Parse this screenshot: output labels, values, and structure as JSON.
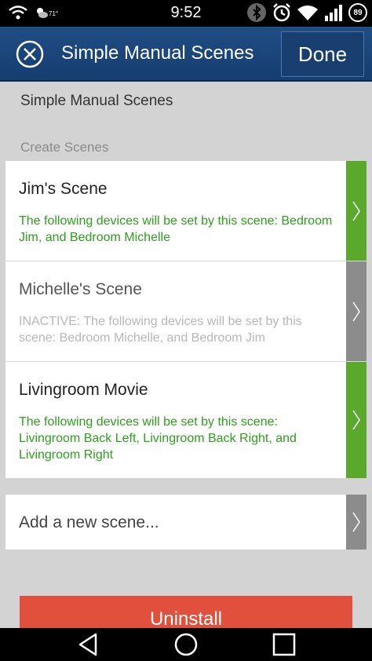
{
  "status_bar": {
    "time": "9:52",
    "temperature": "71°",
    "battery": "89"
  },
  "app_bar": {
    "title": "Simple Manual Scenes",
    "done_label": "Done"
  },
  "content": {
    "section_title": "Simple Manual Scenes",
    "section_subtitle": "Create Scenes",
    "scenes": [
      {
        "title": "Jim's Scene",
        "description": "The following devices will be set by this scene: Bedroom Jim, and Bedroom Michelle",
        "active": true
      },
      {
        "title": "Michelle's Scene",
        "description": "INACTIVE: The following devices will be set by this scene: Bedroom Michelle, and Bedroom Jim",
        "active": false
      },
      {
        "title": "Livingroom Movie",
        "description": "The following devices will be set by this scene: Livingroom Back Left, Livingroom Back Right, and Livingroom Right",
        "active": true
      }
    ],
    "add_scene_label": "Add a new scene...",
    "uninstall_label": "Uninstall"
  },
  "colors": {
    "accent_active": "#5aa82c",
    "accent_inactive": "#8c8c8c",
    "header": "#1f4d84",
    "danger": "#e0503c",
    "description_active": "#2e9e1d"
  },
  "icons": {
    "close": "close-circle-icon",
    "chevron": "chevron-right-icon",
    "back": "back-triangle-icon",
    "home": "home-circle-icon",
    "recents": "recents-square-icon"
  }
}
